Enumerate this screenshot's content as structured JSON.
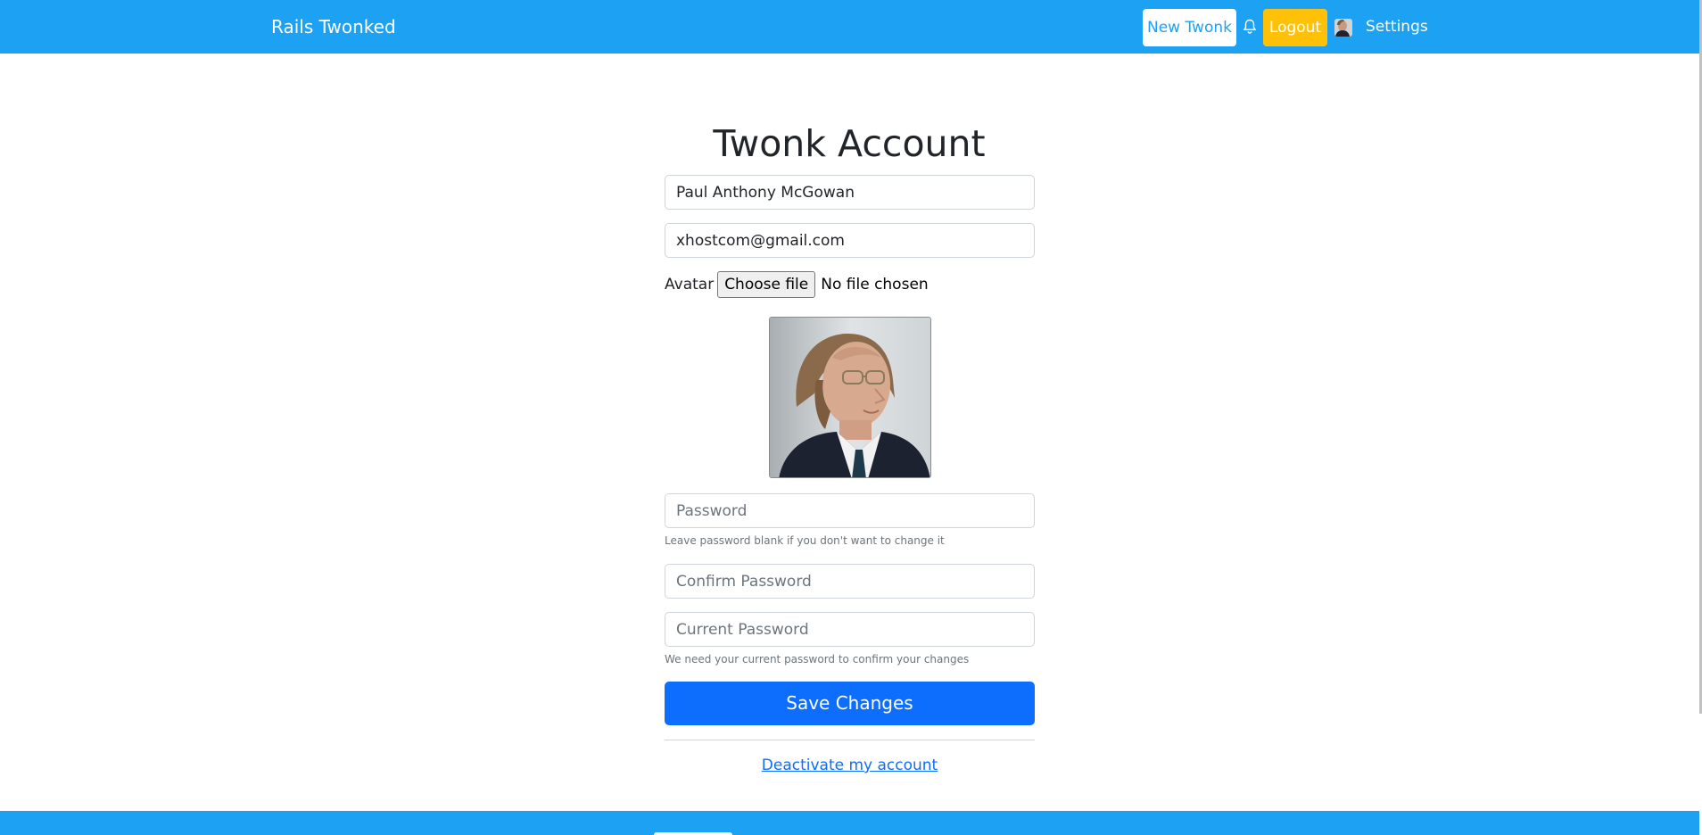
{
  "navbar": {
    "brand": "Rails Twonked",
    "new_twonk": "New Twonk",
    "logout": "Logout",
    "settings": "Settings",
    "bell_icon": "bell-icon",
    "accent": "#1da1f2",
    "logout_color": "#ffc107"
  },
  "page": {
    "title": "Twonk Account"
  },
  "form": {
    "name_value": "Paul Anthony McGowan",
    "email_value": "xhostcom@gmail.com",
    "avatar_label": "Avatar",
    "choose_file": "Choose file",
    "file_status": "No file chosen",
    "password_placeholder": "Password",
    "password_help": "Leave password blank if you don't want to change it",
    "confirm_placeholder": "Confirm Password",
    "current_placeholder": "Current Password",
    "current_help": "We need your current password to confirm your changes",
    "save_label": "Save Changes",
    "save_color": "#0d6efd"
  },
  "footer_links": {
    "deactivate": "Deactivate my account"
  }
}
